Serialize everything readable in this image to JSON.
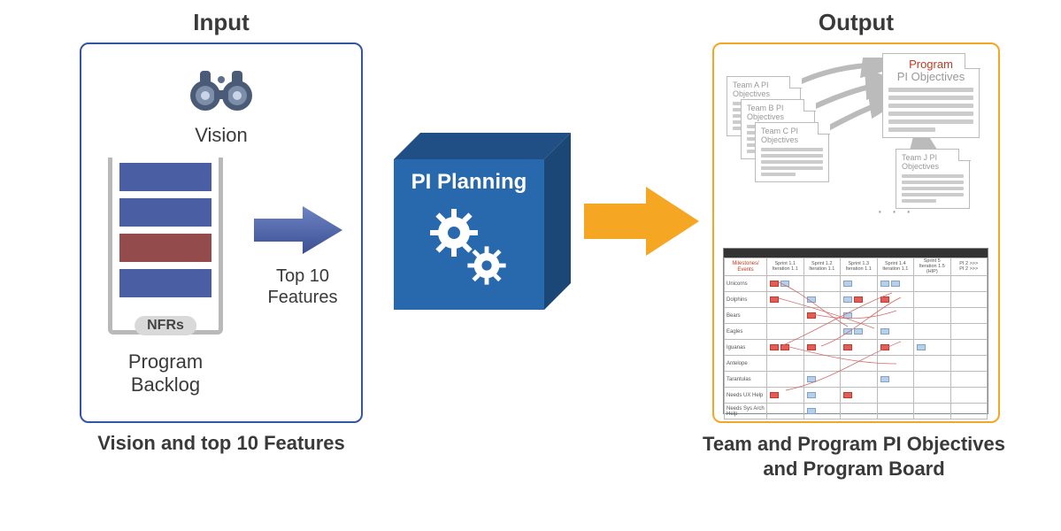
{
  "titles": {
    "input": "Input",
    "output": "Output",
    "center": "PI Planning"
  },
  "input": {
    "vision_label": "Vision",
    "nfrs_label": "NFRs",
    "backlog_label": "Program\nBacklog",
    "top10_label": "Top 10\nFeatures",
    "caption": "Vision and top 10 Features"
  },
  "output": {
    "team_docs": [
      {
        "title1": "Team A PI",
        "title2": "Objectives"
      },
      {
        "title1": "Team B PI",
        "title2": "Objectives"
      },
      {
        "title1": "Team C PI",
        "title2": "Objectives"
      },
      {
        "title1": "Team J PI",
        "title2": "Objectives"
      }
    ],
    "program_doc": {
      "title_red": "Program",
      "title2": "PI Objectives"
    },
    "ellipsis": "· · ·",
    "caption": "Team and Program PI Objectives\nand Program Board",
    "board": {
      "corner": "Milestones/\nEvents",
      "columns": [
        {
          "l1": "Sprint 1.1",
          "l2": "Iteration 1.1"
        },
        {
          "l1": "Sprint 1.2",
          "l2": "Iteration 1.1"
        },
        {
          "l1": "Sprint 1.3",
          "l2": "Iteration 1.1"
        },
        {
          "l1": "Sprint 1.4",
          "l2": "Iteration 1.1"
        },
        {
          "l1": "Sprint 5",
          "l2": "Iteration 1.5\n(HIP)"
        },
        {
          "l1": "PI 2 >>>",
          "l2": "PI 2 >>>"
        }
      ],
      "rows": [
        "Unicorns",
        "Dolphins",
        "Bears",
        "Eagles",
        "Iguanas",
        "Antelope",
        "Tarantulas",
        "Needs UX Help",
        "Needs Sys Arch Help"
      ]
    }
  }
}
